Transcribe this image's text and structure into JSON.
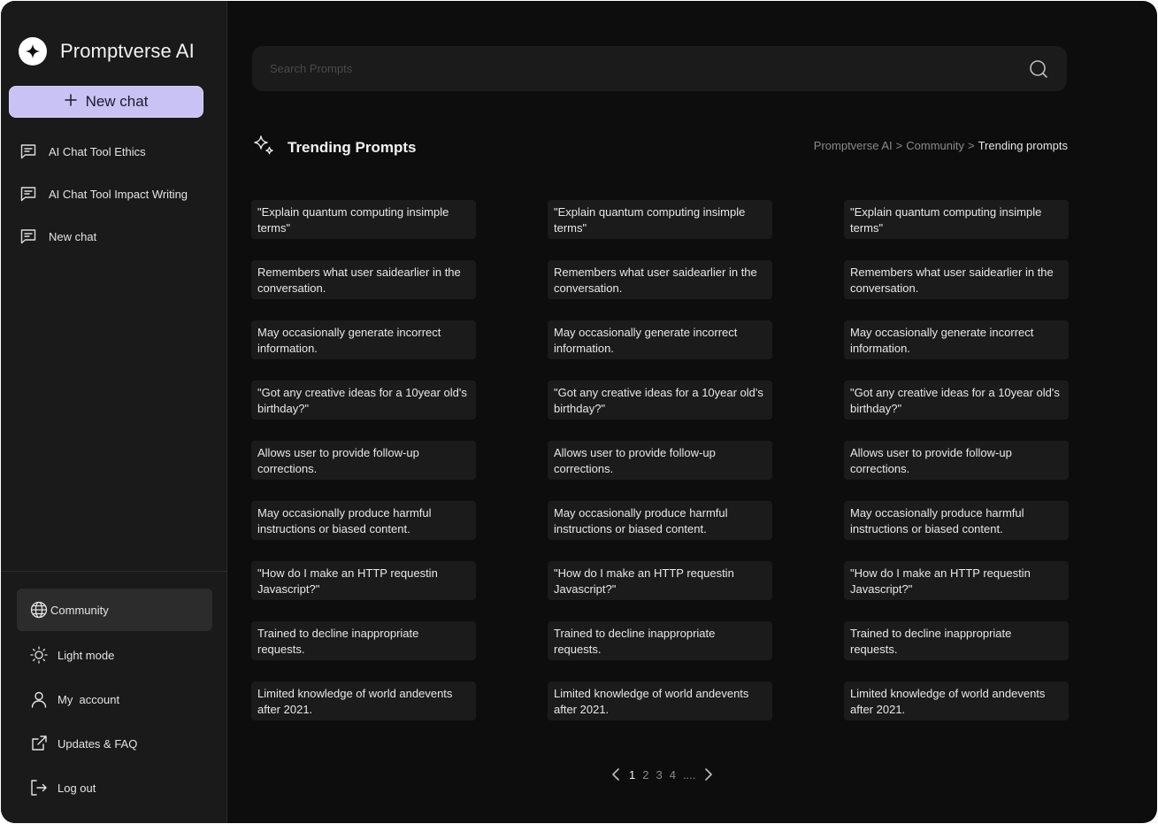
{
  "app": {
    "title": "Promptverse AI"
  },
  "sidebar": {
    "new_chat_label": "New chat",
    "chats": [
      {
        "label": "AI Chat Tool Ethics",
        "icon": "chat-bubble-icon"
      },
      {
        "label": "AI Chat Tool Impact Writing",
        "icon": "chat-bubble-icon"
      },
      {
        "label": "New chat",
        "icon": "chat-bubble-icon"
      }
    ],
    "nav": [
      {
        "label": "Community",
        "icon": "globe-icon",
        "active": true
      },
      {
        "label": "Light mode",
        "icon": "sun-icon"
      },
      {
        "label": "My  account",
        "icon": "user-icon"
      },
      {
        "label": "Updates & FAQ",
        "icon": "external-link-icon"
      },
      {
        "label": "Log out",
        "icon": "logout-icon"
      }
    ]
  },
  "search": {
    "placeholder": "Search Prompts",
    "value": ""
  },
  "section": {
    "title": "Trending Prompts",
    "icon": "sparkles-icon",
    "breadcrumb": {
      "root": "Promptverse AI",
      "sep": ">",
      "middle": "Community",
      "current": "Trending prompts"
    }
  },
  "prompts": [
    "\"Explain quantum computing insimple terms\"",
    "\"Explain quantum computing insimple terms\"",
    "\"Explain quantum computing insimple terms\"",
    "Remembers what user saidearlier in the conversation.",
    "Remembers what user saidearlier in the conversation.",
    "Remembers what user saidearlier in the conversation.",
    "May occasionally generate incorrect information.",
    "May occasionally generate incorrect information.",
    "May occasionally generate incorrect information.",
    "\"Got any creative ideas for a 10year old's birthday?\"",
    "\"Got any creative ideas for a 10year old's birthday?\"",
    "\"Got any creative ideas for a 10year old's birthday?\"",
    "Allows user to provide follow-up corrections.",
    "Allows user to provide follow-up corrections.",
    "Allows user to provide follow-up corrections.",
    "May occasionally produce harmful instructions or biased content.",
    "May occasionally produce harmful instructions or biased content.",
    "May occasionally produce harmful instructions or biased content.",
    "\"How do I make an HTTP requestin Javascript?\"",
    "\"How do I make an HTTP requestin Javascript?\"",
    "\"How do I make an HTTP requestin Javascript?\"",
    "Trained to decline inappropriate requests.",
    "Trained to decline inappropriate requests.",
    "Trained to decline inappropriate requests.",
    "Limited knowledge of world andevents after 2021.",
    "Limited knowledge of world andevents after 2021.",
    "Limited knowledge of world andevents after 2021."
  ],
  "pagination": {
    "pages": [
      "1",
      "2",
      "3",
      "4",
      "...."
    ],
    "current": "1"
  },
  "colors": {
    "accent": "#c9c2f5",
    "background": "#0d0d0d",
    "sidebar": "#1a1a1a",
    "card": "#1b1b1b"
  }
}
